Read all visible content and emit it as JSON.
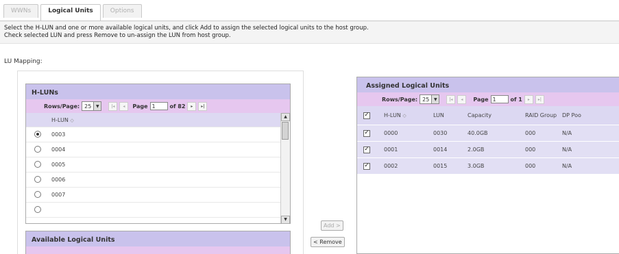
{
  "tabs": [
    {
      "label": "WWNs",
      "active": false
    },
    {
      "label": "Logical Units",
      "active": true
    },
    {
      "label": "Options",
      "active": false
    }
  ],
  "instructions": {
    "line1": "Select the H-LUN and one or more available logical units, and click Add to assign the selected logical units to the host group.",
    "line2": "Check selected LUN and press Remove to un-assign the LUN from host group."
  },
  "lu_mapping_label": "LU Mapping:",
  "hluns_panel": {
    "title": "H-LUNs",
    "rows_per_page_label": "Rows/Page:",
    "rows_per_page_value": "25",
    "page_label": "Page",
    "page_value": "1",
    "of_pages": "of 82",
    "column_header": "H-LUN",
    "rows": [
      "0003",
      "0004",
      "0005",
      "0006",
      "0007"
    ],
    "selected_index": 0
  },
  "available_panel": {
    "title": "Available Logical Units"
  },
  "buttons": {
    "add": "Add >",
    "remove": "< Remove"
  },
  "assigned_panel": {
    "title": "Assigned Logical Units",
    "rows_per_page_label": "Rows/Page:",
    "rows_per_page_value": "25",
    "page_label": "Page",
    "page_value": "1",
    "of_pages": "of 1",
    "columns": [
      "H-LUN",
      "LUN",
      "Capacity",
      "RAID Group",
      "DP Poo"
    ],
    "rows": [
      {
        "hlun": "0000",
        "lun": "0030",
        "capacity": "40.0GB",
        "raid": "000",
        "dp": "N/A"
      },
      {
        "hlun": "0001",
        "lun": "0014",
        "capacity": "2.0GB",
        "raid": "000",
        "dp": "N/A"
      },
      {
        "hlun": "0002",
        "lun": "0015",
        "capacity": "3.0GB",
        "raid": "000",
        "dp": "N/A"
      }
    ]
  },
  "colors": {
    "panel_header": "#c9c2ec",
    "pager_bar": "#e6c7ef",
    "row_highlight": "#e2dff4"
  }
}
